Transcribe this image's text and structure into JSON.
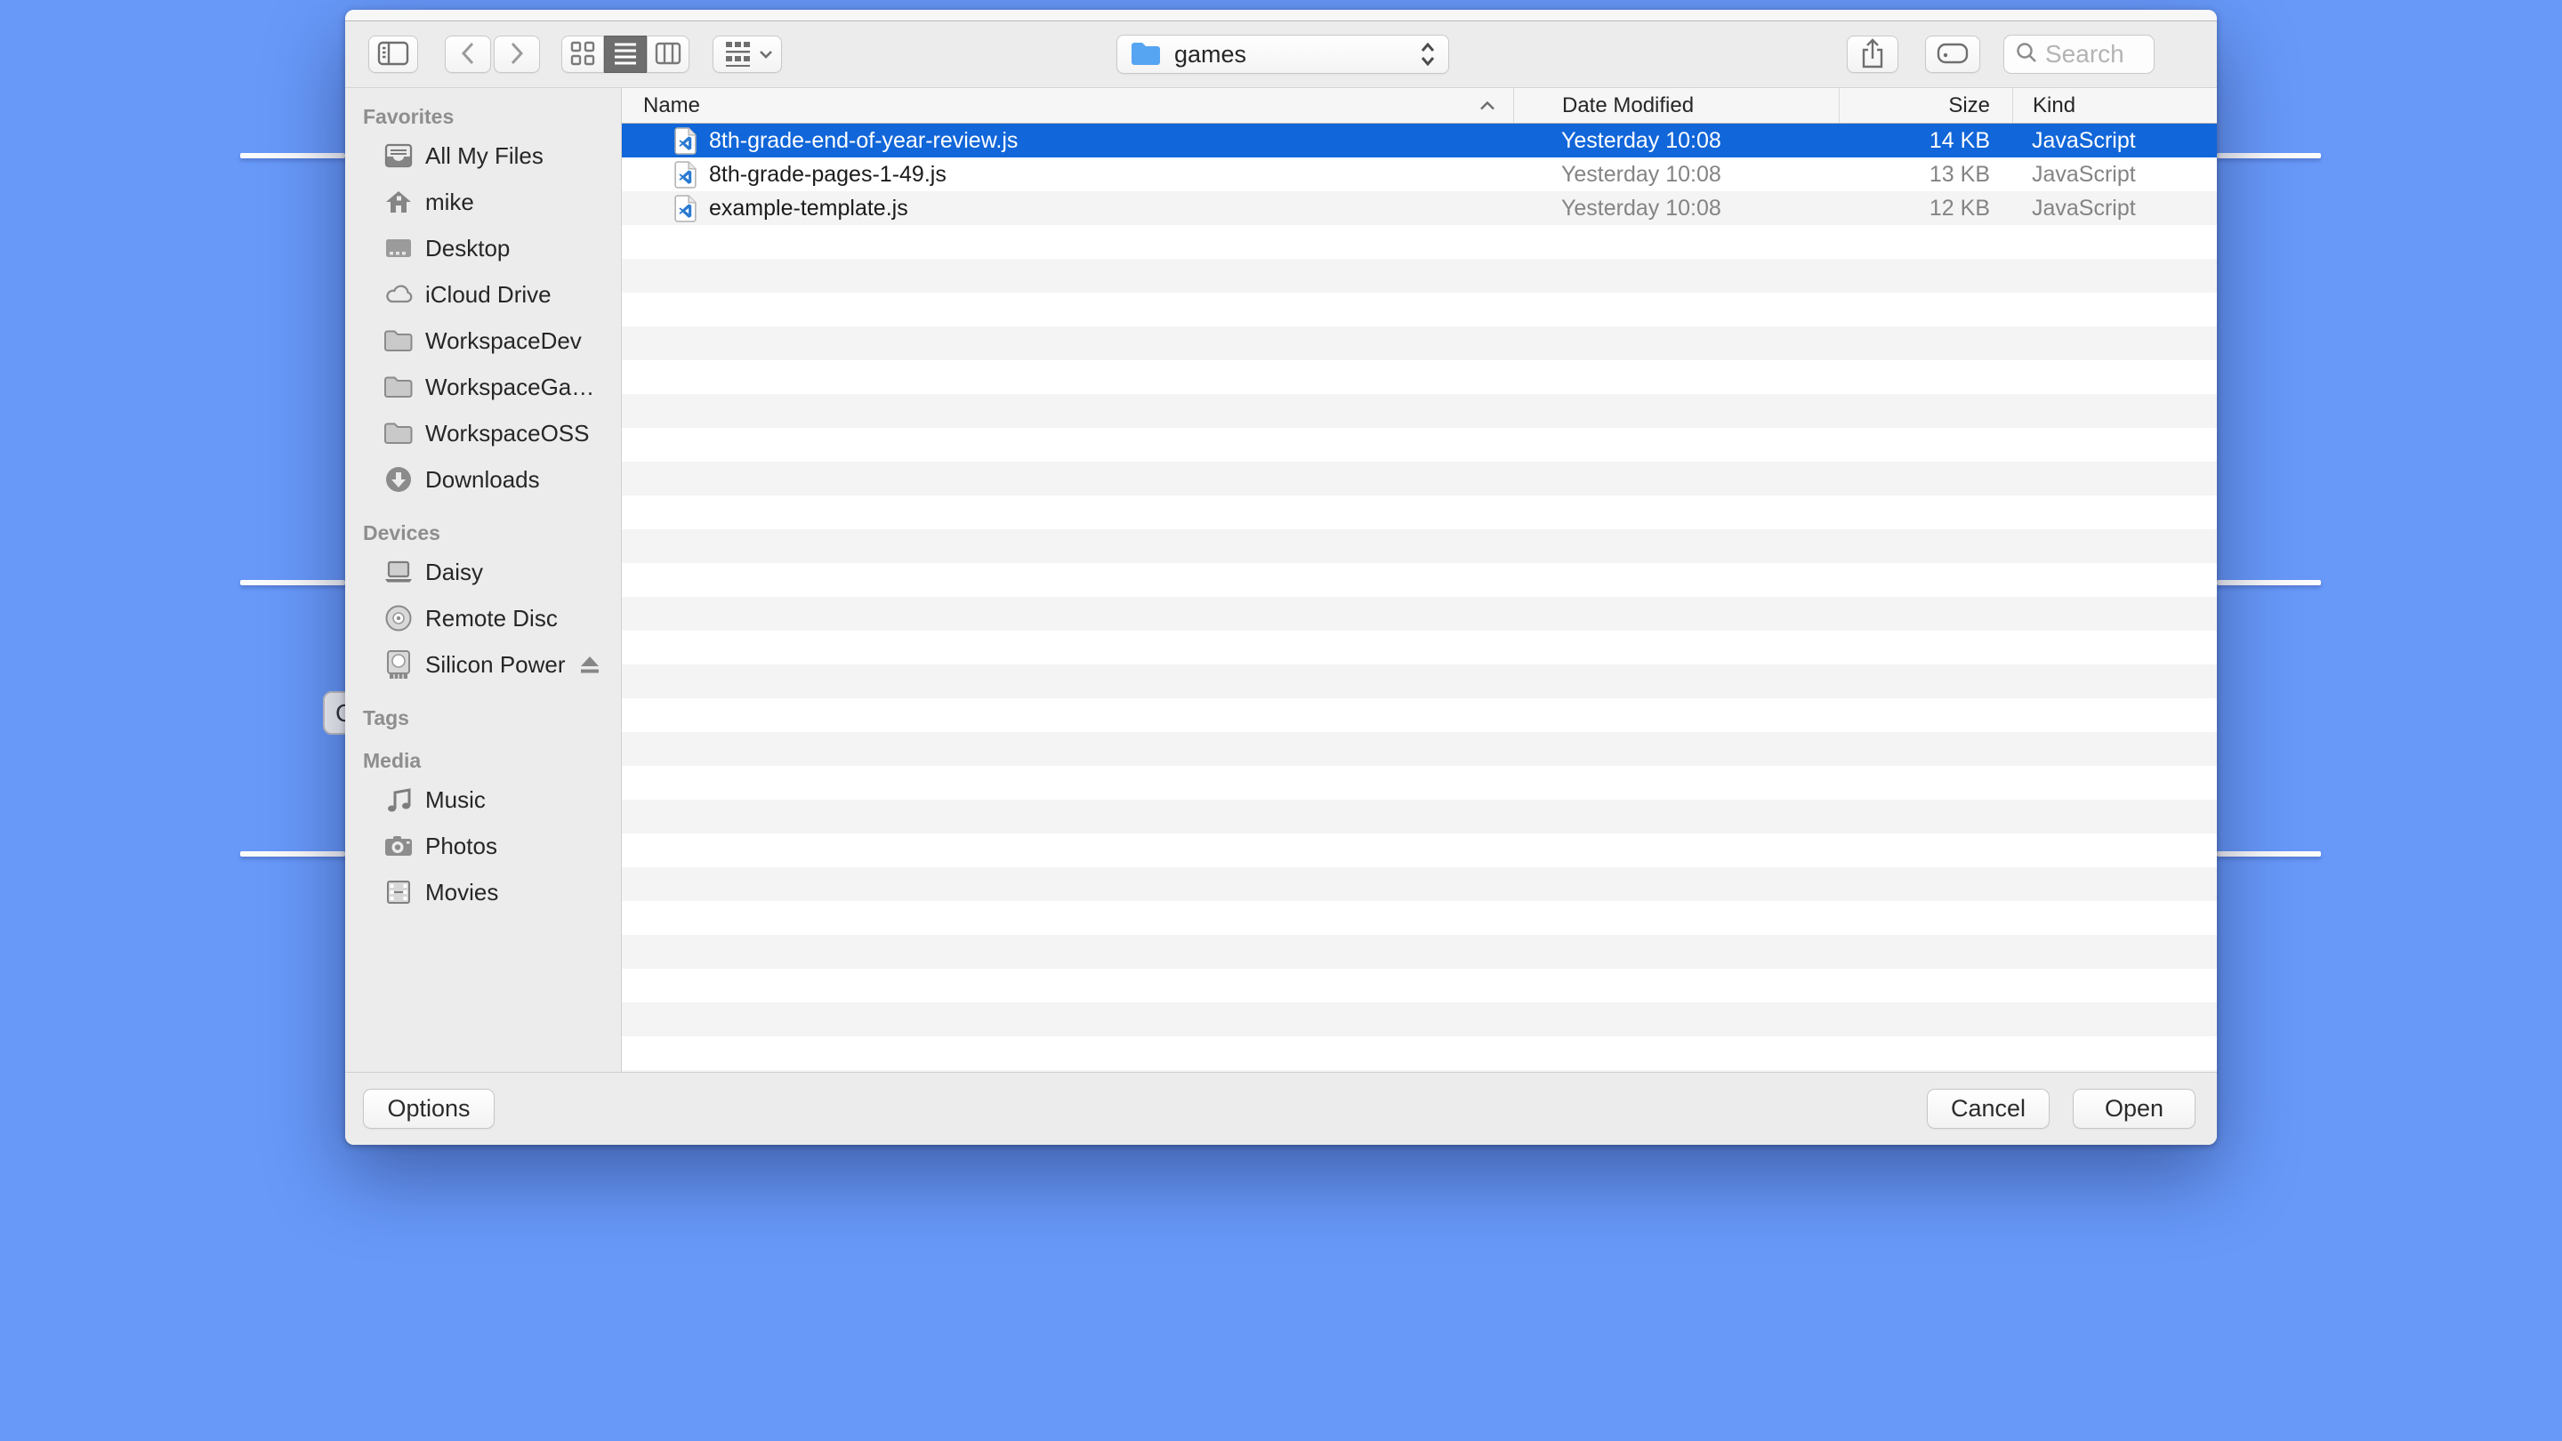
{
  "toolbar": {
    "sidebar_toggle_icon": "sidebar-toggle-icon",
    "back_icon": "chevron-left-icon",
    "forward_icon": "chevron-right-icon",
    "view_modes": [
      {
        "name": "icon-view",
        "icon": "grid-icon",
        "selected": false
      },
      {
        "name": "list-view",
        "icon": "list-icon",
        "selected": true
      },
      {
        "name": "column-view",
        "icon": "columns-icon",
        "selected": false
      }
    ],
    "grouping_icon": "item-arrangement-icon",
    "path_selector": {
      "icon": "folder-icon",
      "label": "games"
    },
    "share_icon": "share-icon",
    "tag_icon": "tag-icon",
    "search": {
      "icon": "magnifier-icon",
      "placeholder": "Search"
    }
  },
  "sidebar": {
    "sections": [
      {
        "label": "Favorites",
        "items": [
          {
            "icon": "tray-icon",
            "label": "All My Files"
          },
          {
            "icon": "home-icon",
            "label": "mike"
          },
          {
            "icon": "desktop-icon",
            "label": "Desktop"
          },
          {
            "icon": "cloud-icon",
            "label": "iCloud Drive"
          },
          {
            "icon": "folder-icon",
            "label": "WorkspaceDev"
          },
          {
            "icon": "folder-icon",
            "label": "WorkspaceGa…"
          },
          {
            "icon": "folder-icon",
            "label": "WorkspaceOSS"
          },
          {
            "icon": "download-circle-icon",
            "label": "Downloads"
          }
        ]
      },
      {
        "label": "Devices",
        "items": [
          {
            "icon": "laptop-icon",
            "label": "Daisy"
          },
          {
            "icon": "disc-icon",
            "label": "Remote Disc"
          },
          {
            "icon": "external-drive-icon",
            "label": "Silicon Power",
            "eject": true
          }
        ]
      },
      {
        "label": "Tags",
        "items": []
      },
      {
        "label": "Media",
        "items": [
          {
            "icon": "music-note-icon",
            "label": "Music"
          },
          {
            "icon": "camera-icon",
            "label": "Photos"
          },
          {
            "icon": "film-icon",
            "label": "Movies"
          }
        ]
      }
    ]
  },
  "file_list": {
    "columns": [
      {
        "label": "Name",
        "sort": "ascending"
      },
      {
        "label": "Date Modified",
        "sort": null
      },
      {
        "label": "Size",
        "sort": null
      },
      {
        "label": "Kind",
        "sort": null
      }
    ],
    "rows": [
      {
        "icon": "javascript-file-icon",
        "name": "8th-grade-end-of-year-review.js",
        "date_modified": "Yesterday 10:08",
        "size": "14 KB",
        "kind": "JavaScript",
        "selected": true
      },
      {
        "icon": "javascript-file-icon",
        "name": "8th-grade-pages-1-49.js",
        "date_modified": "Yesterday 10:08",
        "size": "13 KB",
        "kind": "JavaScript",
        "selected": false
      },
      {
        "icon": "javascript-file-icon",
        "name": "example-template.js",
        "date_modified": "Yesterday 10:08",
        "size": "12 KB",
        "kind": "JavaScript",
        "selected": false
      }
    ]
  },
  "footer": {
    "options": "Options",
    "cancel": "Cancel",
    "open": "Open"
  },
  "desktop": {
    "obscured_button_label": "C"
  },
  "colors": {
    "desktop_background": "#6899f9",
    "selection_blue": "#1166d9",
    "folder_blue": "#55a5f3",
    "file_icon_blue": "#2a7ad1",
    "toolbar_gray": "#ececec"
  }
}
